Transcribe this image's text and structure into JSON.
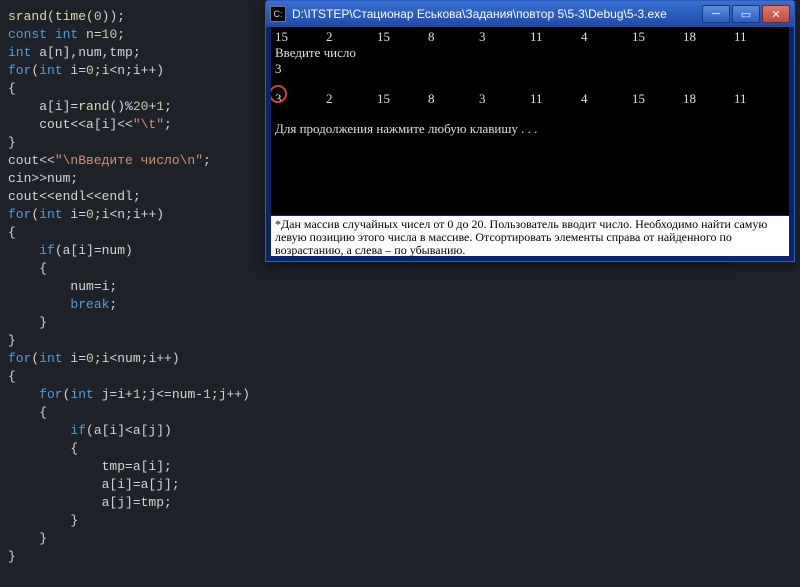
{
  "code": {
    "l1a": "srand",
    "l1b": "(",
    "l1c": "time",
    "l1d": "(",
    "l1e": "0",
    "l1f": "));",
    "l2a": "const",
    "l2b": " int",
    "l2c": " n=",
    "l2d": "10",
    "l2e": ";",
    "l3a": "int",
    "l3b": " a[n],num,tmp;",
    "l4a": "for",
    "l4b": "(",
    "l4c": "int",
    "l4d": " i=",
    "l4e": "0",
    "l4f": ";i<n;i++)",
    "l5": "{",
    "l6a": "    a[i]=",
    "l6b": "rand",
    "l6c": "()%",
    "l6d": "20",
    "l6e": "+",
    "l6f": "1",
    "l6g": ";",
    "l7a": "    cout<<a[i]<<",
    "l7b": "\"\\t\"",
    "l7c": ";",
    "l8": "}",
    "l9a": "cout<<",
    "l9b": "\"\\nВведите число\\n\"",
    "l9c": ";",
    "l10": "cin>>num;",
    "l11": "cout<<endl<<endl;",
    "l12a": "for",
    "l12b": "(",
    "l12c": "int",
    "l12d": " i=",
    "l12e": "0",
    "l12f": ";i<n;i++)",
    "l13": "{",
    "l14a": "    if",
    "l14b": "(a[i]=num)",
    "l15": "    {",
    "l16": "        num=i;",
    "l17a": "        break",
    "l17b": ";",
    "l18": "    }",
    "l19": "}",
    "l20": "",
    "l21a": "for",
    "l21b": "(",
    "l21c": "int",
    "l21d": " i=",
    "l21e": "0",
    "l21f": ";i<num;i++)",
    "l22": "{",
    "l23a": "    for",
    "l23b": "(",
    "l23c": "int",
    "l23d": " j=i+",
    "l23e": "1",
    "l23f": ";j<=num-",
    "l23g": "1",
    "l23h": ";j++)",
    "l24": "    {",
    "l25a": "        if",
    "l25b": "(a[i]<a[j])",
    "l26": "        {",
    "l27": "            tmp=a[i];",
    "l28": "            a[i]=a[j];",
    "l29": "            a[j]=tmp;",
    "l30": "        }",
    "l31": "    }",
    "l32": "}"
  },
  "console": {
    "title": "D:\\ITSTEP\\Стационар Еськова\\Задания\\повтор 5\\5-3\\Debug\\5-3.exe",
    "row1": [
      "15",
      "2",
      "15",
      "8",
      "3",
      "11",
      "4",
      "15",
      "18",
      "11"
    ],
    "prompt": "Введите число",
    "input": "3",
    "row2": [
      "3",
      "2",
      "15",
      "8",
      "3",
      "11",
      "4",
      "15",
      "18",
      "11"
    ],
    "cont": "Для продолжения нажмите любую клавишу . . .",
    "desc": "*Дан массив случайных чисел от 0 до 20. Пользователь вводит число. Необходимо найти самую левую позицию этого числа в массиве. Отсортировать элементы справа от найденного по возрастанию, а слева – по убыванию."
  },
  "winbtn": {
    "min": "─",
    "max": "▭",
    "close": "✕"
  }
}
